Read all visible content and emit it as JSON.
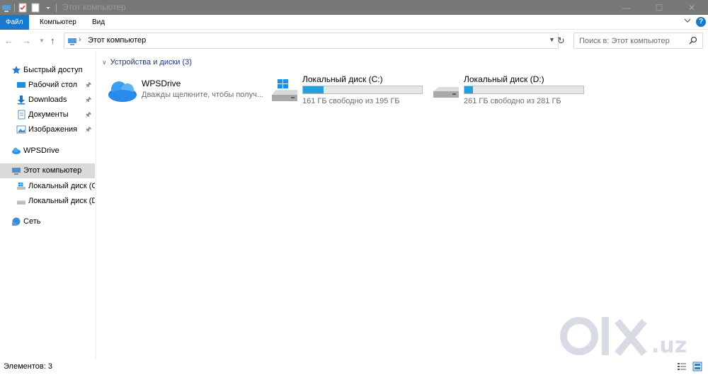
{
  "window": {
    "title": "Этот компьютер",
    "buttons": {
      "minimize": "—",
      "maximize": "☐",
      "close": "✕"
    }
  },
  "ribbon": {
    "tabs": [
      {
        "label": "Файл",
        "active": true
      },
      {
        "label": "Компьютер",
        "active": false
      },
      {
        "label": "Вид",
        "active": false
      }
    ],
    "help": "?"
  },
  "address": {
    "path": "Этот компьютер",
    "search_placeholder": "Поиск в: Этот компьютер"
  },
  "nav": {
    "quick_access": "Быстрый доступ",
    "items": [
      {
        "label": "Рабочий стол",
        "icon": "desktop-icon",
        "pinned": true
      },
      {
        "label": "Downloads",
        "icon": "download-icon",
        "pinned": true
      },
      {
        "label": "Документы",
        "icon": "documents-icon",
        "pinned": true
      },
      {
        "label": "Изображения",
        "icon": "pictures-icon",
        "pinned": true
      }
    ],
    "wpsdrive": "WPSDrive",
    "this_pc": "Этот компьютер",
    "drive_c": "Локальный диск (C",
    "drive_d": "Локальный диск (D",
    "network": "Сеть"
  },
  "content": {
    "group_title": "Устройства и диски (3)",
    "tiles": [
      {
        "name": "WPSDrive",
        "sub": "Дважды щелкните, чтобы получ...",
        "icon": "cloud-icon"
      },
      {
        "name": "Локальный диск (C:)",
        "sub": "161 ГБ свободно из 195 ГБ",
        "used_fraction": 0.17,
        "icon": "windows-drive-icon"
      },
      {
        "name": "Локальный диск (D:)",
        "sub": "261 ГБ свободно из 281 ГБ",
        "used_fraction": 0.07,
        "icon": "drive-icon"
      }
    ]
  },
  "status": {
    "items_count": "Элементов: 3"
  },
  "watermark": {
    "text": "olx.uz"
  },
  "colors": {
    "accent": "#1979ca",
    "bar_fill": "#26a0da",
    "titlebar": "#777777"
  }
}
